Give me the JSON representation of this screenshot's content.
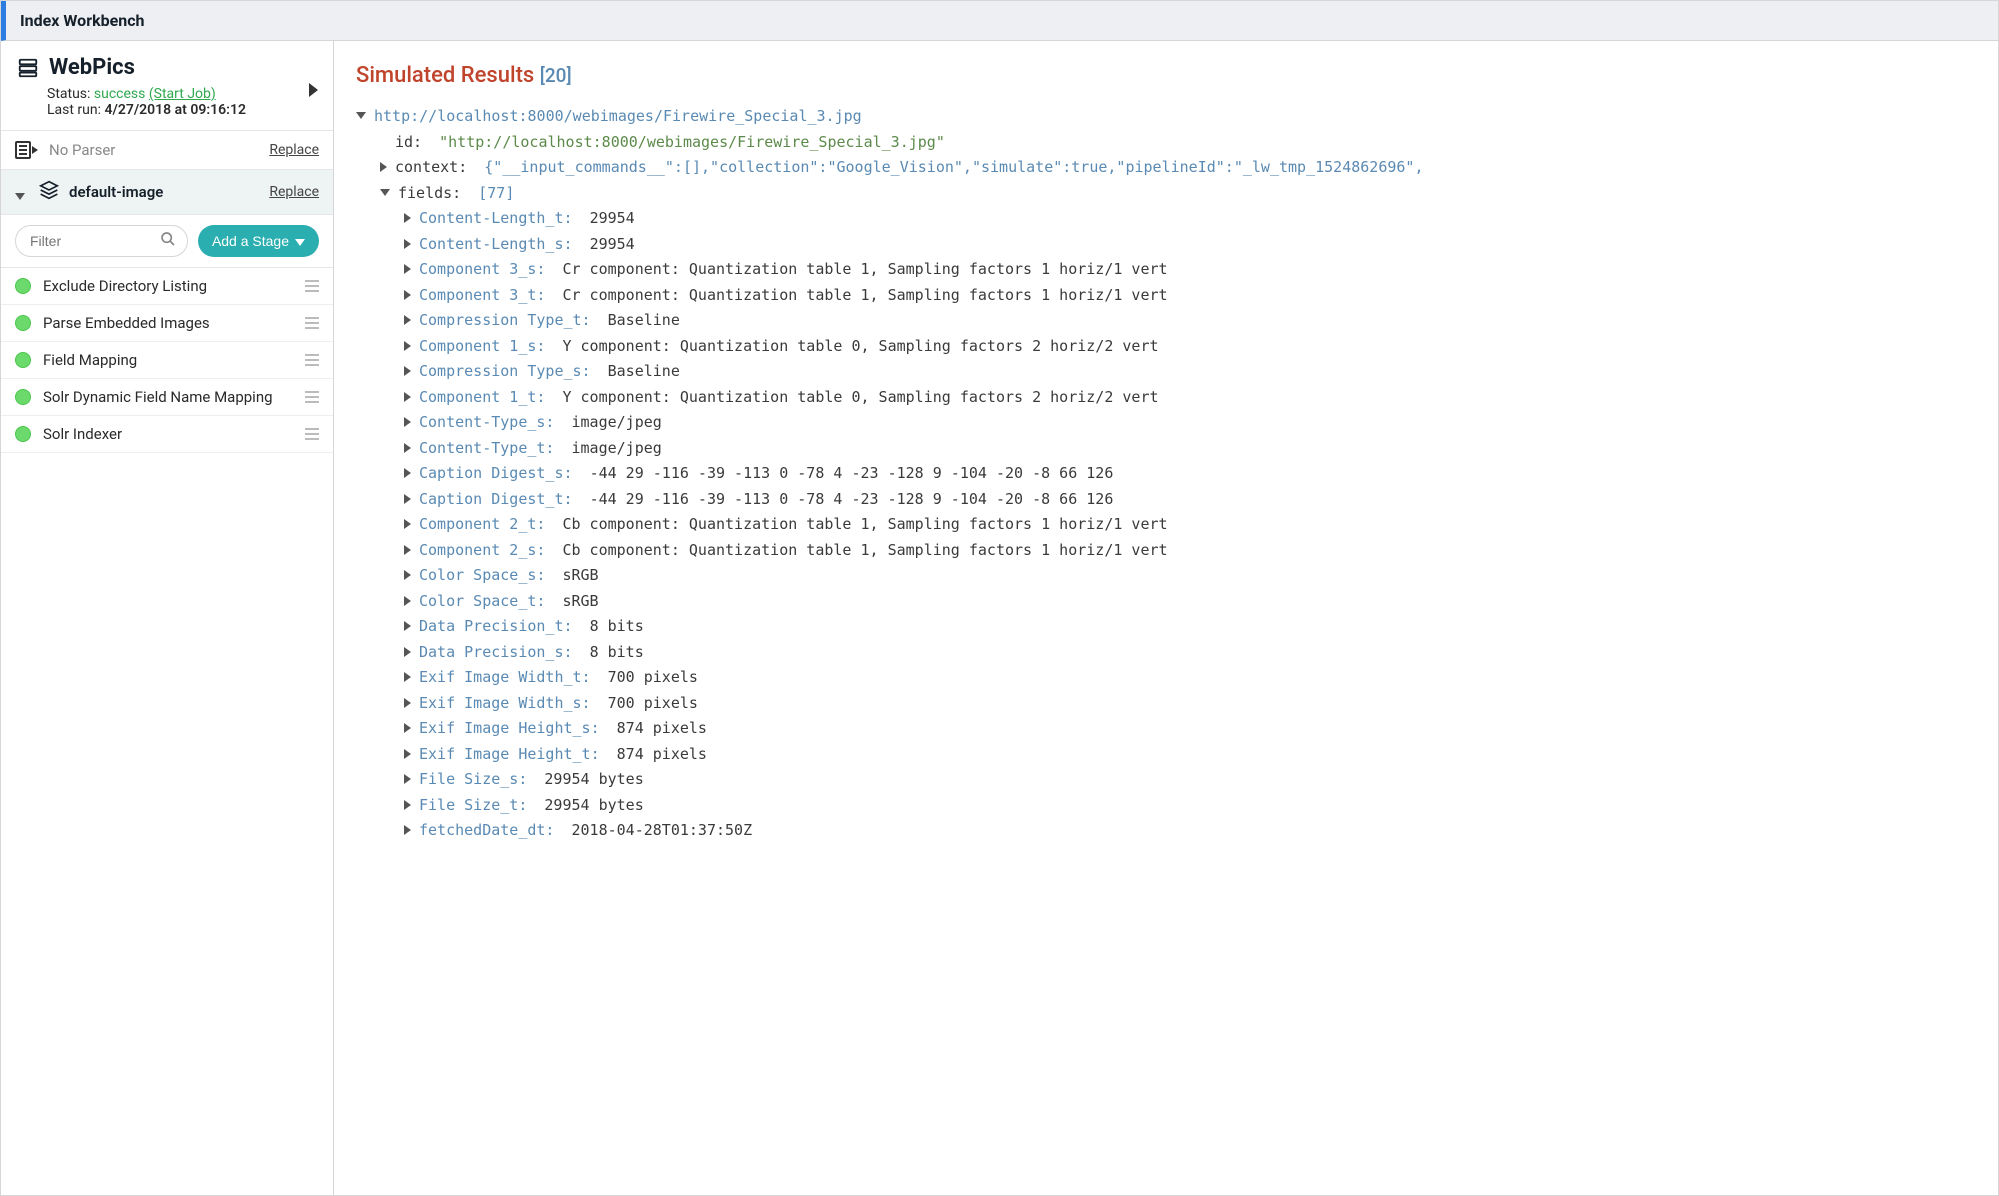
{
  "titlebar": "Index Workbench",
  "sidebar": {
    "project": "WebPics",
    "status_label": "Status:",
    "status_value": "success",
    "start_job": "(Start Job)",
    "lastrun_label": "Last run:",
    "lastrun_value": "4/27/2018 at 09:16:12",
    "parser_label": "No Parser",
    "replace": "Replace",
    "pipeline_label": "default-image",
    "filter_placeholder": "Filter",
    "add_stage": "Add a Stage",
    "stages": [
      "Exclude Directory Listing",
      "Parse Embedded Images",
      "Field Mapping",
      "Solr Dynamic Field Name Mapping",
      "Solr Indexer"
    ]
  },
  "results": {
    "title": "Simulated Results",
    "count": "[20]",
    "doc_url": "http://localhost:8000/webimages/Firewire_Special_3.jpg",
    "id_label": "id:",
    "id_value": "\"http://localhost:8000/webimages/Firewire_Special_3.jpg\"",
    "context_label": "context:",
    "context_value": "{\"__input_commands__\":[],\"collection\":\"Google_Vision\",\"simulate\":true,\"pipelineId\":\"_lw_tmp_1524862696\",",
    "fields_label": "fields:",
    "fields_count": "[77]",
    "fields": [
      {
        "k": "Content-Length_t:",
        "v": "29954"
      },
      {
        "k": "Content-Length_s:",
        "v": "29954"
      },
      {
        "k": "Component 3_s:",
        "v": "Cr component: Quantization table 1, Sampling factors 1 horiz/1 vert"
      },
      {
        "k": "Component 3_t:",
        "v": "Cr component: Quantization table 1, Sampling factors 1 horiz/1 vert"
      },
      {
        "k": "Compression Type_t:",
        "v": "Baseline"
      },
      {
        "k": "Component 1_s:",
        "v": "Y component: Quantization table 0, Sampling factors 2 horiz/2 vert"
      },
      {
        "k": "Compression Type_s:",
        "v": "Baseline"
      },
      {
        "k": "Component 1_t:",
        "v": "Y component: Quantization table 0, Sampling factors 2 horiz/2 vert"
      },
      {
        "k": "Content-Type_s:",
        "v": "image/jpeg"
      },
      {
        "k": "Content-Type_t:",
        "v": "image/jpeg"
      },
      {
        "k": "Caption Digest_s:",
        "v": "-44 29 -116 -39 -113 0 -78 4 -23 -128 9 -104 -20 -8 66 126"
      },
      {
        "k": "Caption Digest_t:",
        "v": "-44 29 -116 -39 -113 0 -78 4 -23 -128 9 -104 -20 -8 66 126"
      },
      {
        "k": "Component 2_t:",
        "v": "Cb component: Quantization table 1, Sampling factors 1 horiz/1 vert"
      },
      {
        "k": "Component 2_s:",
        "v": "Cb component: Quantization table 1, Sampling factors 1 horiz/1 vert"
      },
      {
        "k": "Color Space_s:",
        "v": "sRGB"
      },
      {
        "k": "Color Space_t:",
        "v": "sRGB"
      },
      {
        "k": "Data Precision_t:",
        "v": "8 bits"
      },
      {
        "k": "Data Precision_s:",
        "v": "8 bits"
      },
      {
        "k": "Exif Image Width_t:",
        "v": "700 pixels"
      },
      {
        "k": "Exif Image Width_s:",
        "v": "700 pixels"
      },
      {
        "k": "Exif Image Height_s:",
        "v": "874 pixels"
      },
      {
        "k": "Exif Image Height_t:",
        "v": "874 pixels"
      },
      {
        "k": "File Size_s:",
        "v": "29954 bytes"
      },
      {
        "k": "File Size_t:",
        "v": "29954 bytes"
      },
      {
        "k": "fetchedDate_dt:",
        "v": "2018-04-28T01:37:50Z"
      }
    ]
  }
}
